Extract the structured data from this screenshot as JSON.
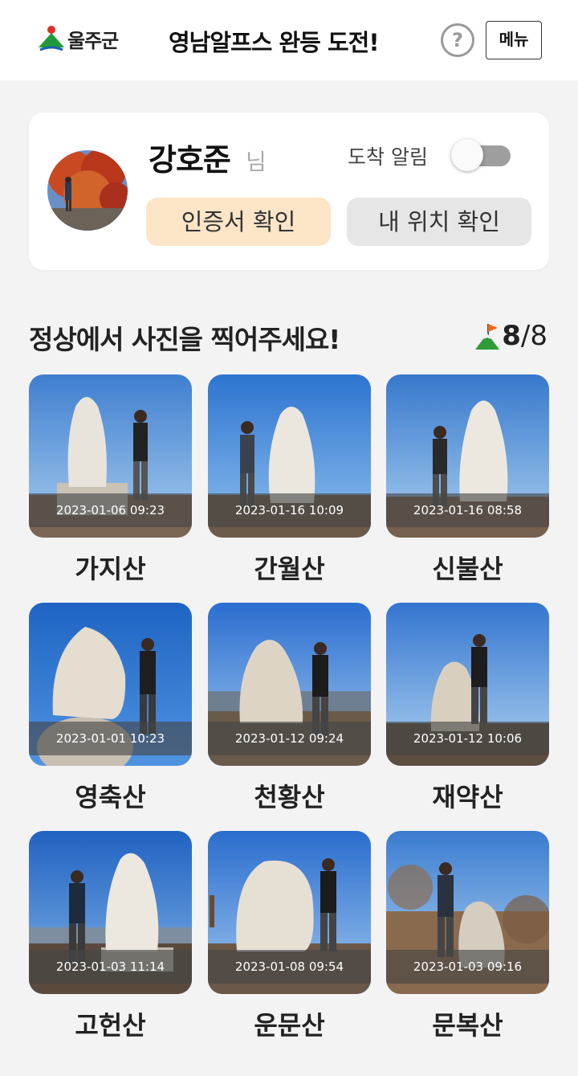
{
  "header": {
    "logo_text": "울주군",
    "title": "영남알프스 완등 도전!",
    "help_label": "?",
    "menu_label": "메뉴"
  },
  "profile": {
    "name": "강호준",
    "suffix": "님",
    "alarm_label": "도착 알림",
    "alarm_on": false,
    "certificate_button": "인증서 확인",
    "location_button": "내 위치 확인"
  },
  "section": {
    "title": "정상에서 사진을 찍어주세요!",
    "completed": "8",
    "separator": "/",
    "total": "8"
  },
  "mountains": [
    {
      "name": "가지산",
      "timestamp": "2023-01-06 09:23"
    },
    {
      "name": "간월산",
      "timestamp": "2023-01-16 10:09"
    },
    {
      "name": "신불산",
      "timestamp": "2023-01-16 08:58"
    },
    {
      "name": "영축산",
      "timestamp": "2023-01-01 10:23"
    },
    {
      "name": "천황산",
      "timestamp": "2023-01-12 09:24"
    },
    {
      "name": "재약산",
      "timestamp": "2023-01-12 10:06"
    },
    {
      "name": "고헌산",
      "timestamp": "2023-01-03 11:14"
    },
    {
      "name": "운문산",
      "timestamp": "2023-01-08 09:54"
    },
    {
      "name": "문복산",
      "timestamp": "2023-01-03 09:16"
    }
  ],
  "colors": {
    "certificate_button_bg": "#fde5c8",
    "location_button_bg": "#e6e6e6",
    "toggle_off": "#9e9e9e",
    "flag_orange": "#f06a1c",
    "mountain_green": "#2e9c38"
  }
}
